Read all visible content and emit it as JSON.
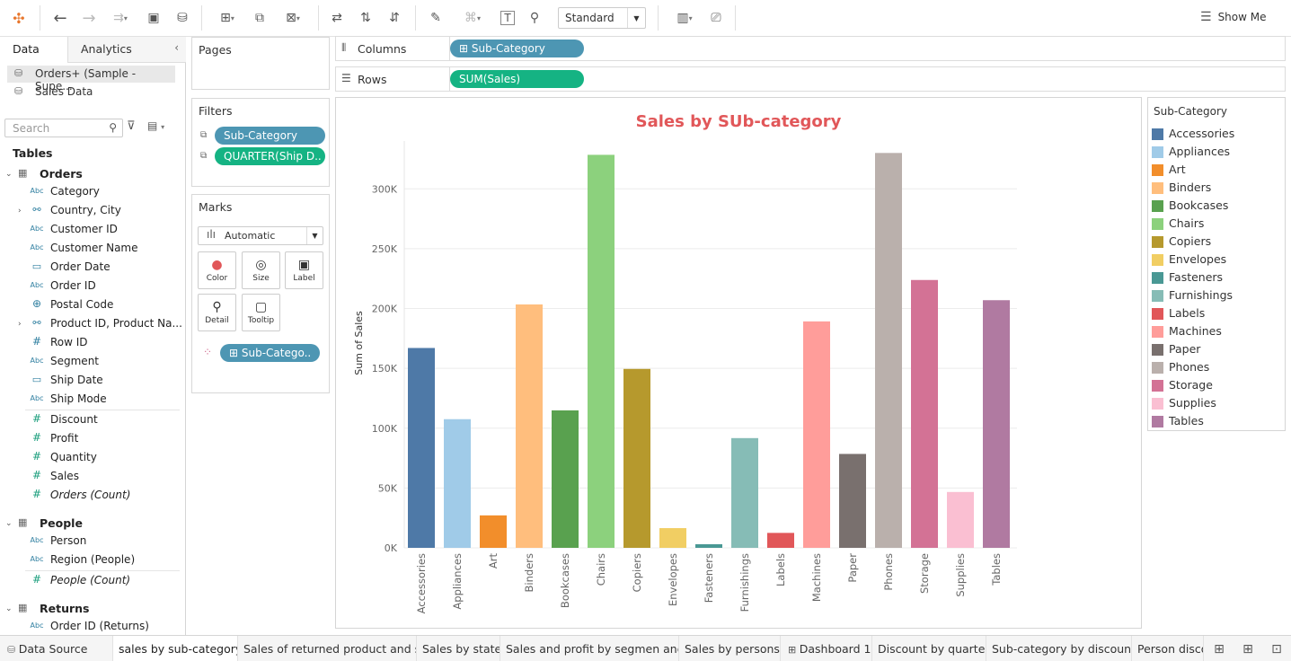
{
  "toolbar": {
    "standard_label": "Standard",
    "show_me_label": "Show Me"
  },
  "left_panel": {
    "tabs": [
      "Data",
      "Analytics"
    ],
    "data_sources": [
      "Orders+ (Sample - Supe...",
      "Sales Data"
    ],
    "search_placeholder": "Search",
    "tables_label": "Tables",
    "orders": {
      "name": "Orders",
      "dimensions": [
        {
          "type": "Abc",
          "name": "Category"
        },
        {
          "type": "geo",
          "name": "Country, City"
        },
        {
          "type": "Abc",
          "name": "Customer ID"
        },
        {
          "type": "Abc",
          "name": "Customer Name"
        },
        {
          "type": "date",
          "name": "Order Date"
        },
        {
          "type": "Abc",
          "name": "Order ID"
        },
        {
          "type": "globe",
          "name": "Postal Code"
        },
        {
          "type": "geo",
          "name": "Product ID, Product Na..."
        },
        {
          "type": "#",
          "name": "Row ID"
        },
        {
          "type": "Abc",
          "name": "Segment"
        },
        {
          "type": "date",
          "name": "Ship Date"
        },
        {
          "type": "Abc",
          "name": "Ship Mode"
        }
      ],
      "measures": [
        "Discount",
        "Profit",
        "Quantity",
        "Sales",
        "Orders (Count)"
      ]
    },
    "people": {
      "name": "People",
      "dimensions": [
        "Person",
        "Region (People)"
      ],
      "measures": [
        "People (Count)"
      ]
    },
    "returns": {
      "name": "Returns",
      "dimensions": [
        "Order ID (Returns)"
      ]
    }
  },
  "cards": {
    "pages_title": "Pages",
    "filters_title": "Filters",
    "filters": [
      "Sub-Category",
      "QUARTER(Ship D.."
    ],
    "marks_title": "Marks",
    "mark_type": "Automatic",
    "mark_buttons": [
      "Color",
      "Size",
      "Label",
      "Detail",
      "Tooltip"
    ],
    "color_pill": "Sub-Catego.."
  },
  "shelves": {
    "columns_label": "Columns",
    "columns_pill": "Sub-Category",
    "rows_label": "Rows",
    "rows_pill": "SUM(Sales)"
  },
  "legend": {
    "title": "Sub-Category"
  },
  "chart_data": {
    "type": "bar",
    "title": "Sales by SUb-category",
    "xlabel": "",
    "ylabel": "Sum of Sales",
    "categories": [
      "Accessories",
      "Appliances",
      "Art",
      "Binders",
      "Bookcases",
      "Chairs",
      "Copiers",
      "Envelopes",
      "Fasteners",
      "Furnishings",
      "Labels",
      "Machines",
      "Paper",
      "Phones",
      "Storage",
      "Supplies",
      "Tables"
    ],
    "values": [
      167026,
      107532,
      27119,
      203413,
      114880,
      328449,
      149528,
      16476,
      3024,
      91705,
      12486,
      189239,
      78479,
      330007,
      223844,
      46674,
      206966
    ],
    "colors": [
      "#4e79a7",
      "#a0cbe8",
      "#f28e2b",
      "#ffbe7d",
      "#59a14f",
      "#8cd17d",
      "#b6992d",
      "#f1ce63",
      "#499894",
      "#86bcb6",
      "#e15759",
      "#ff9d9a",
      "#79706e",
      "#bab0ac",
      "#d37295",
      "#fabfd2",
      "#b07aa1"
    ],
    "yticks": [
      "0K",
      "50K",
      "100K",
      "150K",
      "200K",
      "250K",
      "300K"
    ],
    "ylim": [
      0,
      340000
    ],
    "grid": true,
    "legend_position": "right"
  },
  "sheet_tabs": [
    "Data Source",
    "sales by sub-category",
    "Sales of returned product and s...",
    "Sales by state",
    "Sales and profit by segmen and ...",
    "Sales by persons",
    "Dashboard 1",
    "Discount by quarter",
    "Sub-category by discount",
    "Person disco"
  ],
  "accent_colors": {
    "title_red": "#e15759",
    "dimension_pill": "#4d96b3",
    "measure_pill": "#15b383"
  }
}
